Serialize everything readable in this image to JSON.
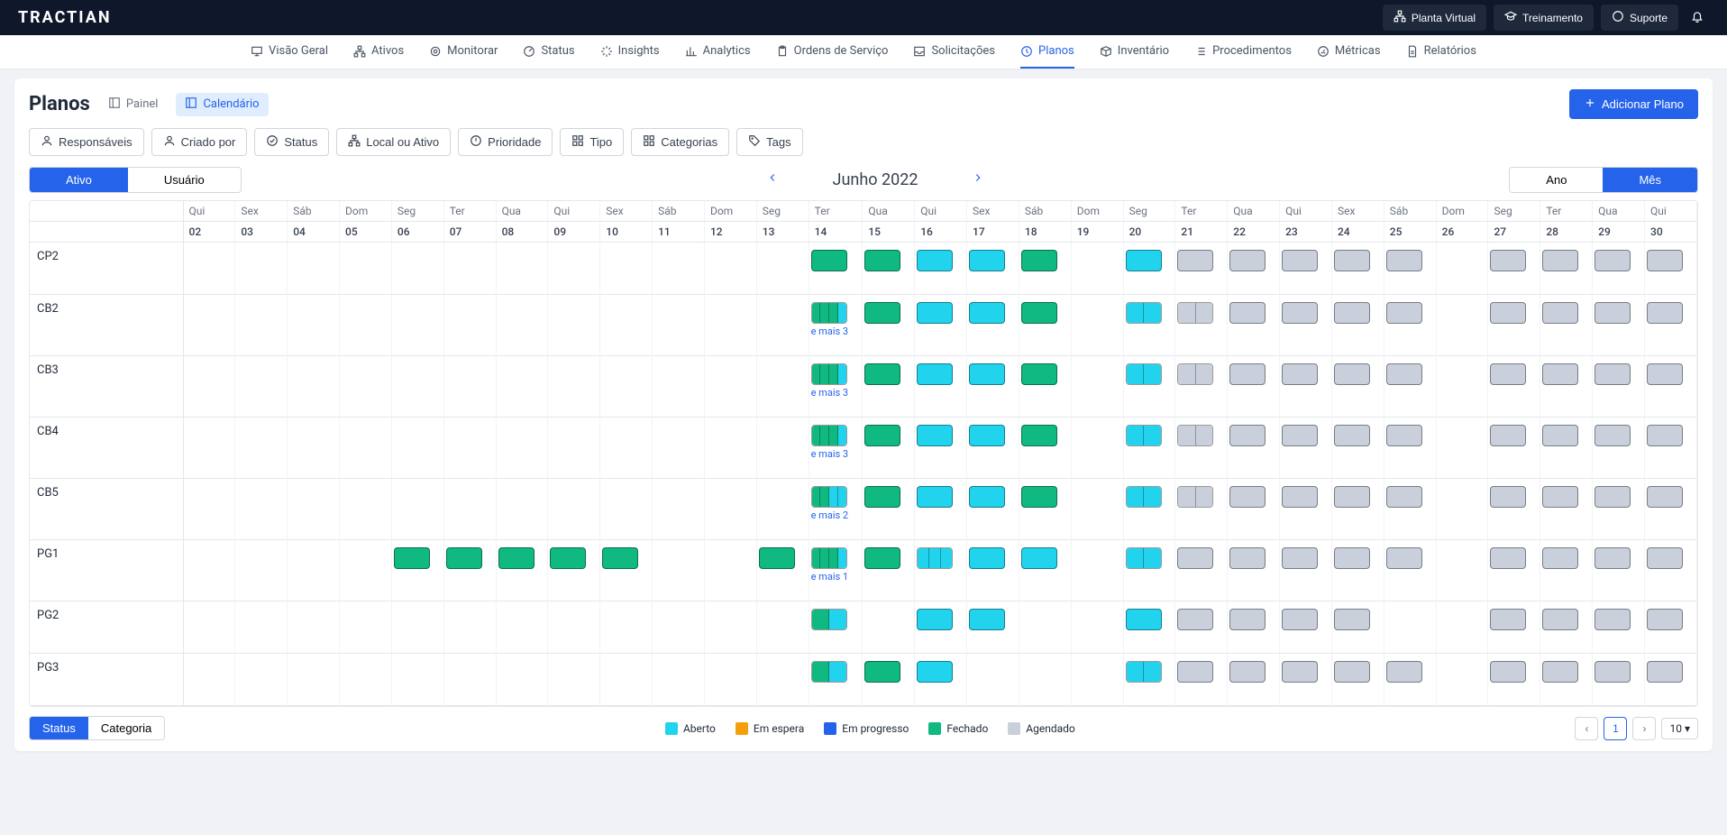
{
  "brand": "TRACTIAN",
  "top_actions": {
    "virtual_plant": "Planta Virtual",
    "training": "Treinamento",
    "support": "Suporte"
  },
  "nav": [
    {
      "label": "Visão Geral",
      "icon": "monitor"
    },
    {
      "label": "Ativos",
      "icon": "sitemap"
    },
    {
      "label": "Monitorar",
      "icon": "target"
    },
    {
      "label": "Status",
      "icon": "gauge"
    },
    {
      "label": "Insights",
      "icon": "sparkle"
    },
    {
      "label": "Analytics",
      "icon": "bars"
    },
    {
      "label": "Ordens de Serviço",
      "icon": "clipboard"
    },
    {
      "label": "Solicitações",
      "icon": "inbox"
    },
    {
      "label": "Planos",
      "icon": "clock",
      "active": true
    },
    {
      "label": "Inventário",
      "icon": "box"
    },
    {
      "label": "Procedimentos",
      "icon": "list"
    },
    {
      "label": "Métricas",
      "icon": "speed"
    },
    {
      "label": "Relatórios",
      "icon": "doc"
    }
  ],
  "page_title": "Planos",
  "views": {
    "panel": "Painel",
    "calendar": "Calendário"
  },
  "add_button": "Adicionar Plano",
  "filters": [
    {
      "label": "Responsáveis",
      "icon": "user"
    },
    {
      "label": "Criado por",
      "icon": "user"
    },
    {
      "label": "Status",
      "icon": "check"
    },
    {
      "label": "Local ou Ativo",
      "icon": "sitemap"
    },
    {
      "label": "Prioridade",
      "icon": "alert"
    },
    {
      "label": "Tipo",
      "icon": "grid"
    },
    {
      "label": "Categorias",
      "icon": "grid"
    },
    {
      "label": "Tags",
      "icon": "tag"
    }
  ],
  "segment_left": {
    "asset": "Ativo",
    "user": "Usuário"
  },
  "segment_right": {
    "year": "Ano",
    "month": "Mês"
  },
  "month": "Junho 2022",
  "days": [
    {
      "dow": "Qui",
      "num": "02"
    },
    {
      "dow": "Sex",
      "num": "03"
    },
    {
      "dow": "Sáb",
      "num": "04"
    },
    {
      "dow": "Dom",
      "num": "05"
    },
    {
      "dow": "Seg",
      "num": "06"
    },
    {
      "dow": "Ter",
      "num": "07"
    },
    {
      "dow": "Qua",
      "num": "08"
    },
    {
      "dow": "Qui",
      "num": "09"
    },
    {
      "dow": "Sex",
      "num": "10"
    },
    {
      "dow": "Sáb",
      "num": "11"
    },
    {
      "dow": "Dom",
      "num": "12"
    },
    {
      "dow": "Seg",
      "num": "13"
    },
    {
      "dow": "Ter",
      "num": "14"
    },
    {
      "dow": "Qua",
      "num": "15"
    },
    {
      "dow": "Qui",
      "num": "16"
    },
    {
      "dow": "Sex",
      "num": "17"
    },
    {
      "dow": "Sáb",
      "num": "18"
    },
    {
      "dow": "Dom",
      "num": "19"
    },
    {
      "dow": "Seg",
      "num": "20"
    },
    {
      "dow": "Ter",
      "num": "21"
    },
    {
      "dow": "Qua",
      "num": "22"
    },
    {
      "dow": "Qui",
      "num": "23"
    },
    {
      "dow": "Sex",
      "num": "24"
    },
    {
      "dow": "Sáb",
      "num": "25"
    },
    {
      "dow": "Dom",
      "num": "26"
    },
    {
      "dow": "Seg",
      "num": "27"
    },
    {
      "dow": "Ter",
      "num": "28"
    },
    {
      "dow": "Qua",
      "num": "29"
    },
    {
      "dow": "Qui",
      "num": "30"
    }
  ],
  "rows": [
    {
      "name": "CP2",
      "more": null,
      "cells": {
        "14": {
          "t": "box",
          "c": "green"
        },
        "15": {
          "t": "box",
          "c": "green"
        },
        "16": {
          "t": "box",
          "c": "cyan"
        },
        "17": {
          "t": "box",
          "c": "cyan"
        },
        "18": {
          "t": "box",
          "c": "green"
        },
        "20": {
          "t": "box",
          "c": "cyan"
        },
        "21": {
          "t": "box",
          "c": "gray"
        },
        "22": {
          "t": "box",
          "c": "gray"
        },
        "23": {
          "t": "box",
          "c": "gray"
        },
        "24": {
          "t": "box",
          "c": "gray"
        },
        "25": {
          "t": "box",
          "c": "gray"
        },
        "27": {
          "t": "box",
          "c": "gray"
        },
        "28": {
          "t": "box",
          "c": "gray"
        },
        "29": {
          "t": "box",
          "c": "gray"
        },
        "30": {
          "t": "box",
          "c": "gray"
        }
      }
    },
    {
      "name": "CB2",
      "more": "e mais 3",
      "cells": {
        "14": {
          "t": "split",
          "c": [
            "green",
            "green",
            "green",
            "cyan"
          ]
        },
        "15": {
          "t": "box",
          "c": "green"
        },
        "16": {
          "t": "box",
          "c": "cyan"
        },
        "17": {
          "t": "box",
          "c": "cyan"
        },
        "18": {
          "t": "box",
          "c": "green"
        },
        "20": {
          "t": "split",
          "c": [
            "cyan",
            "cyan"
          ]
        },
        "21": {
          "t": "split",
          "c": [
            "gray",
            "gray"
          ]
        },
        "22": {
          "t": "box",
          "c": "gray"
        },
        "23": {
          "t": "box",
          "c": "gray"
        },
        "24": {
          "t": "box",
          "c": "gray"
        },
        "25": {
          "t": "box",
          "c": "gray"
        },
        "27": {
          "t": "box",
          "c": "gray"
        },
        "28": {
          "t": "box",
          "c": "gray"
        },
        "29": {
          "t": "box",
          "c": "gray"
        },
        "30": {
          "t": "box",
          "c": "gray"
        }
      }
    },
    {
      "name": "CB3",
      "more": "e mais 3",
      "cells": {
        "14": {
          "t": "split",
          "c": [
            "green",
            "green",
            "green",
            "cyan"
          ]
        },
        "15": {
          "t": "box",
          "c": "green"
        },
        "16": {
          "t": "box",
          "c": "cyan"
        },
        "17": {
          "t": "box",
          "c": "cyan"
        },
        "18": {
          "t": "box",
          "c": "green"
        },
        "20": {
          "t": "split",
          "c": [
            "cyan",
            "cyan"
          ]
        },
        "21": {
          "t": "split",
          "c": [
            "gray",
            "gray"
          ]
        },
        "22": {
          "t": "box",
          "c": "gray"
        },
        "23": {
          "t": "box",
          "c": "gray"
        },
        "24": {
          "t": "box",
          "c": "gray"
        },
        "25": {
          "t": "box",
          "c": "gray"
        },
        "27": {
          "t": "box",
          "c": "gray"
        },
        "28": {
          "t": "box",
          "c": "gray"
        },
        "29": {
          "t": "box",
          "c": "gray"
        },
        "30": {
          "t": "box",
          "c": "gray"
        }
      }
    },
    {
      "name": "CB4",
      "more": "e mais 3",
      "cells": {
        "14": {
          "t": "split",
          "c": [
            "green",
            "green",
            "green",
            "cyan"
          ]
        },
        "15": {
          "t": "box",
          "c": "green"
        },
        "16": {
          "t": "box",
          "c": "cyan"
        },
        "17": {
          "t": "box",
          "c": "cyan"
        },
        "18": {
          "t": "box",
          "c": "green"
        },
        "20": {
          "t": "split",
          "c": [
            "cyan",
            "cyan"
          ]
        },
        "21": {
          "t": "split",
          "c": [
            "gray",
            "gray"
          ]
        },
        "22": {
          "t": "box",
          "c": "gray"
        },
        "23": {
          "t": "box",
          "c": "gray"
        },
        "24": {
          "t": "box",
          "c": "gray"
        },
        "25": {
          "t": "box",
          "c": "gray"
        },
        "27": {
          "t": "box",
          "c": "gray"
        },
        "28": {
          "t": "box",
          "c": "gray"
        },
        "29": {
          "t": "box",
          "c": "gray"
        },
        "30": {
          "t": "box",
          "c": "gray"
        }
      }
    },
    {
      "name": "CB5",
      "more": "e mais 2",
      "cells": {
        "14": {
          "t": "split",
          "c": [
            "green",
            "green",
            "cyan",
            "cyan"
          ]
        },
        "15": {
          "t": "box",
          "c": "green"
        },
        "16": {
          "t": "box",
          "c": "cyan"
        },
        "17": {
          "t": "box",
          "c": "cyan"
        },
        "18": {
          "t": "box",
          "c": "green"
        },
        "20": {
          "t": "split",
          "c": [
            "cyan",
            "cyan"
          ]
        },
        "21": {
          "t": "split",
          "c": [
            "gray",
            "gray"
          ]
        },
        "22": {
          "t": "box",
          "c": "gray"
        },
        "23": {
          "t": "box",
          "c": "gray"
        },
        "24": {
          "t": "box",
          "c": "gray"
        },
        "25": {
          "t": "box",
          "c": "gray"
        },
        "27": {
          "t": "box",
          "c": "gray"
        },
        "28": {
          "t": "box",
          "c": "gray"
        },
        "29": {
          "t": "box",
          "c": "gray"
        },
        "30": {
          "t": "box",
          "c": "gray"
        }
      }
    },
    {
      "name": "PG1",
      "more": "e mais 1",
      "cells": {
        "06": {
          "t": "box",
          "c": "green"
        },
        "07": {
          "t": "box",
          "c": "green"
        },
        "08": {
          "t": "box",
          "c": "green"
        },
        "09": {
          "t": "box",
          "c": "green"
        },
        "10": {
          "t": "box",
          "c": "green"
        },
        "13": {
          "t": "box",
          "c": "green"
        },
        "14": {
          "t": "split",
          "c": [
            "green",
            "green",
            "green",
            "cyan"
          ]
        },
        "15": {
          "t": "box",
          "c": "green"
        },
        "16": {
          "t": "split",
          "c": [
            "cyan",
            "cyan",
            "cyan"
          ]
        },
        "17": {
          "t": "box",
          "c": "cyan"
        },
        "18": {
          "t": "box",
          "c": "cyan"
        },
        "20": {
          "t": "split",
          "c": [
            "cyan",
            "cyan"
          ]
        },
        "21": {
          "t": "box",
          "c": "gray"
        },
        "22": {
          "t": "box",
          "c": "gray"
        },
        "23": {
          "t": "box",
          "c": "gray"
        },
        "24": {
          "t": "box",
          "c": "gray"
        },
        "25": {
          "t": "box",
          "c": "gray"
        },
        "27": {
          "t": "box",
          "c": "gray"
        },
        "28": {
          "t": "box",
          "c": "gray"
        },
        "29": {
          "t": "box",
          "c": "gray"
        },
        "30": {
          "t": "box",
          "c": "gray"
        }
      }
    },
    {
      "name": "PG2",
      "more": null,
      "cells": {
        "14": {
          "t": "split",
          "c": [
            "green",
            "cyan"
          ]
        },
        "16": {
          "t": "box",
          "c": "cyan"
        },
        "17": {
          "t": "box",
          "c": "cyan"
        },
        "20": {
          "t": "box",
          "c": "cyan"
        },
        "21": {
          "t": "box",
          "c": "gray"
        },
        "22": {
          "t": "box",
          "c": "gray"
        },
        "23": {
          "t": "box",
          "c": "gray"
        },
        "24": {
          "t": "box",
          "c": "gray"
        },
        "27": {
          "t": "box",
          "c": "gray"
        },
        "28": {
          "t": "box",
          "c": "gray"
        },
        "29": {
          "t": "box",
          "c": "gray"
        },
        "30": {
          "t": "box",
          "c": "gray"
        }
      }
    },
    {
      "name": "PG3",
      "more": null,
      "cells": {
        "14": {
          "t": "split",
          "c": [
            "green",
            "cyan"
          ]
        },
        "15": {
          "t": "box",
          "c": "green"
        },
        "16": {
          "t": "box",
          "c": "cyan"
        },
        "20": {
          "t": "split",
          "c": [
            "cyan",
            "cyan"
          ]
        },
        "21": {
          "t": "box",
          "c": "gray"
        },
        "22": {
          "t": "box",
          "c": "gray"
        },
        "23": {
          "t": "box",
          "c": "gray"
        },
        "24": {
          "t": "box",
          "c": "gray"
        },
        "25": {
          "t": "box",
          "c": "gray"
        },
        "27": {
          "t": "box",
          "c": "gray"
        },
        "28": {
          "t": "box",
          "c": "gray"
        },
        "29": {
          "t": "box",
          "c": "gray"
        },
        "30": {
          "t": "box",
          "c": "gray"
        }
      }
    }
  ],
  "footer_seg": {
    "status": "Status",
    "category": "Categoria"
  },
  "legend": [
    {
      "label": "Aberto",
      "color": "#22d3ee"
    },
    {
      "label": "Em espera",
      "color": "#f59e0b"
    },
    {
      "label": "Em progresso",
      "color": "#2563eb"
    },
    {
      "label": "Fechado",
      "color": "#10b981"
    },
    {
      "label": "Agendado",
      "color": "#c9d0dc"
    }
  ],
  "pagination": {
    "current": "1",
    "size": "10"
  }
}
